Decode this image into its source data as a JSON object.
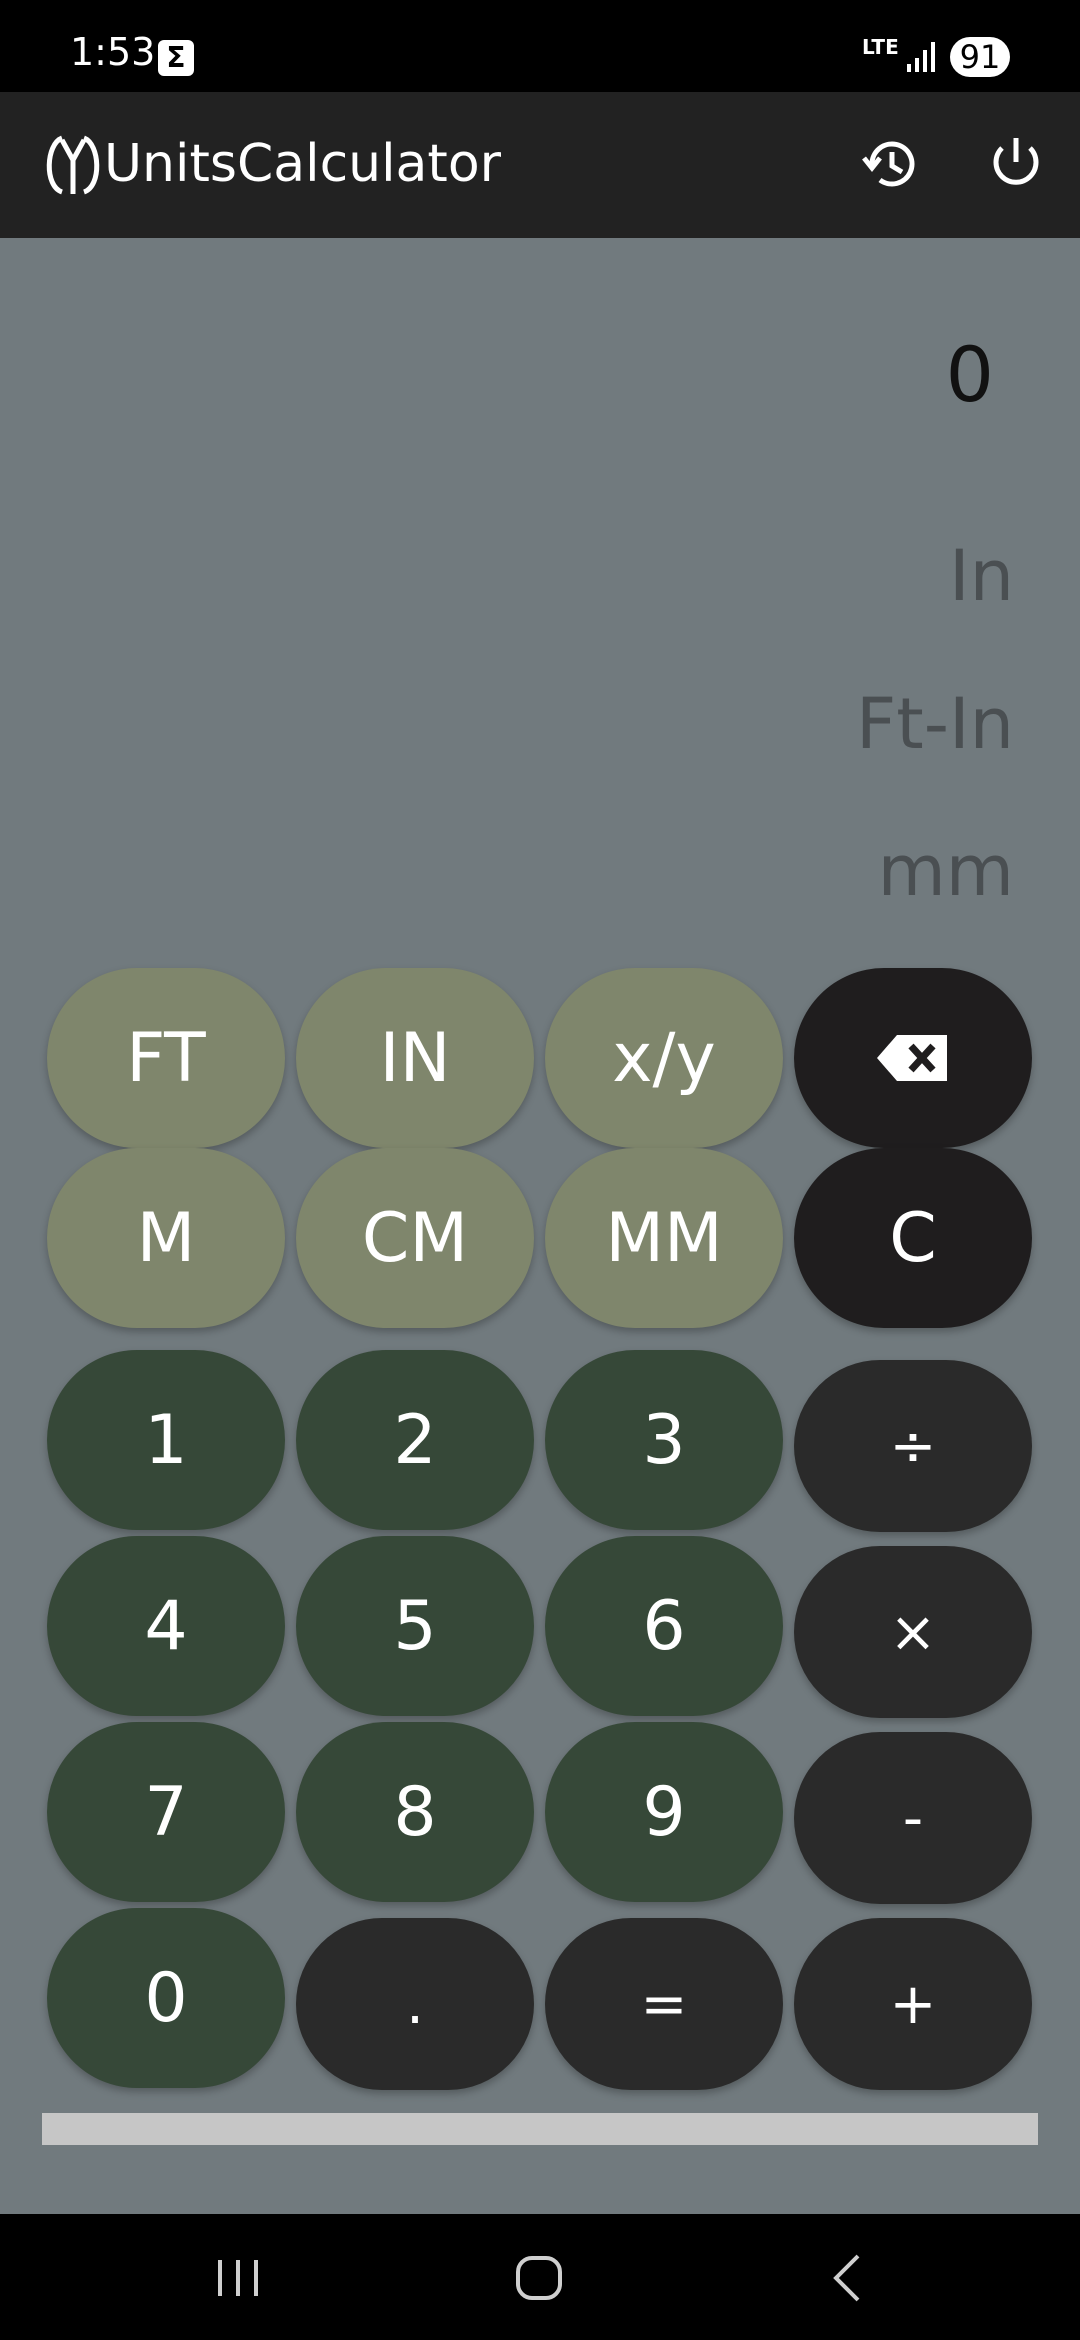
{
  "status_bar": {
    "time": "1:53",
    "notification_icon": "sigma-icon",
    "network": "LTE",
    "battery": "91"
  },
  "app_bar": {
    "title": "UnitsCalculator",
    "logo_icon": "units-calculator-logo",
    "actions": [
      "history-icon",
      "power-icon"
    ]
  },
  "display": {
    "value": "0",
    "unit_lines": [
      "In",
      "Ft-In",
      "mm"
    ]
  },
  "keypad": {
    "unit_row1": [
      "FT",
      "IN",
      "x/y"
    ],
    "backspace_icon": "backspace-icon",
    "unit_row2": [
      "M",
      "CM",
      "MM"
    ],
    "clear": "C",
    "digits": [
      "1",
      "2",
      "3",
      "4",
      "5",
      "6",
      "7",
      "8",
      "9",
      "0"
    ],
    "operators": [
      "÷",
      "×",
      "-",
      "+"
    ],
    "dot": ".",
    "equals": "="
  },
  "colors": {
    "background": "#717a7e",
    "unit_buttons": "#7f866c",
    "digit_buttons": "#364838",
    "operator_buttons": "#2a2a2a",
    "control_buttons": "#1f1d1e"
  },
  "nav_bar": [
    "recents-icon",
    "home-icon",
    "back-icon"
  ]
}
